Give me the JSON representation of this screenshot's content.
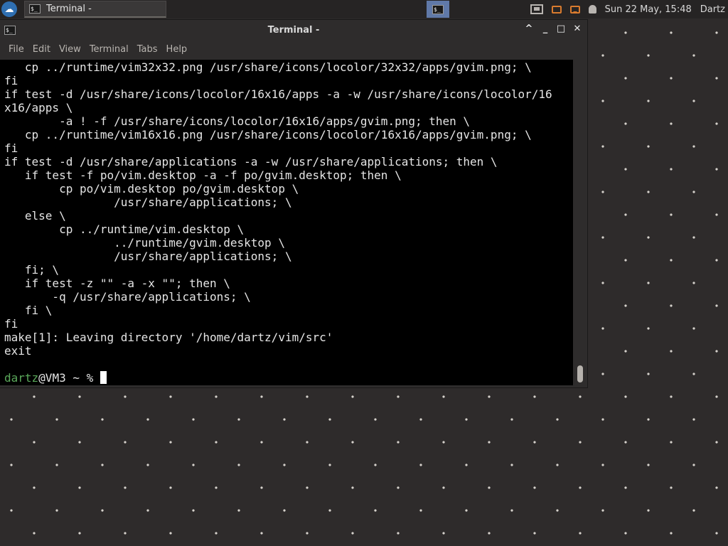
{
  "panel": {
    "taskbar_title": "Terminal -",
    "clock": "Sun 22 May, 15:48",
    "user": "Dartz",
    "icons": [
      "distro-menu-icon",
      "terminal-icon",
      "workspace-switcher-icon",
      "network-icon",
      "window-icon",
      "chat-icon",
      "bell-icon"
    ]
  },
  "window": {
    "title": "Terminal -",
    "menu": [
      "File",
      "Edit",
      "View",
      "Terminal",
      "Tabs",
      "Help"
    ]
  },
  "terminal": {
    "lines": [
      "   cp ../runtime/vim32x32.png /usr/share/icons/locolor/32x32/apps/gvim.png; \\",
      "fi",
      "if test -d /usr/share/icons/locolor/16x16/apps -a -w /usr/share/icons/locolor/16",
      "x16/apps \\",
      "        -a ! -f /usr/share/icons/locolor/16x16/apps/gvim.png; then \\",
      "   cp ../runtime/vim16x16.png /usr/share/icons/locolor/16x16/apps/gvim.png; \\",
      "fi",
      "if test -d /usr/share/applications -a -w /usr/share/applications; then \\",
      "   if test -f po/vim.desktop -a -f po/gvim.desktop; then \\",
      "        cp po/vim.desktop po/gvim.desktop \\",
      "                /usr/share/applications; \\",
      "   else \\",
      "        cp ../runtime/vim.desktop \\",
      "                ../runtime/gvim.desktop \\",
      "                /usr/share/applications; \\",
      "   fi; \\",
      "   if test -z \"\" -a -x \"\"; then \\",
      "       -q /usr/share/applications; \\",
      "   fi \\",
      "fi",
      "make[1]: Leaving directory '/home/dartz/vim/src'",
      "exit",
      ""
    ],
    "prompt_user": "dartz",
    "prompt_rest": "@VM3 ~ % "
  },
  "colors": {
    "accent_blue": "#2f6fb1",
    "workspace_active": "#6079a8",
    "prompt_user": "#5aa85a",
    "tray_orange": "#d97b2e"
  }
}
